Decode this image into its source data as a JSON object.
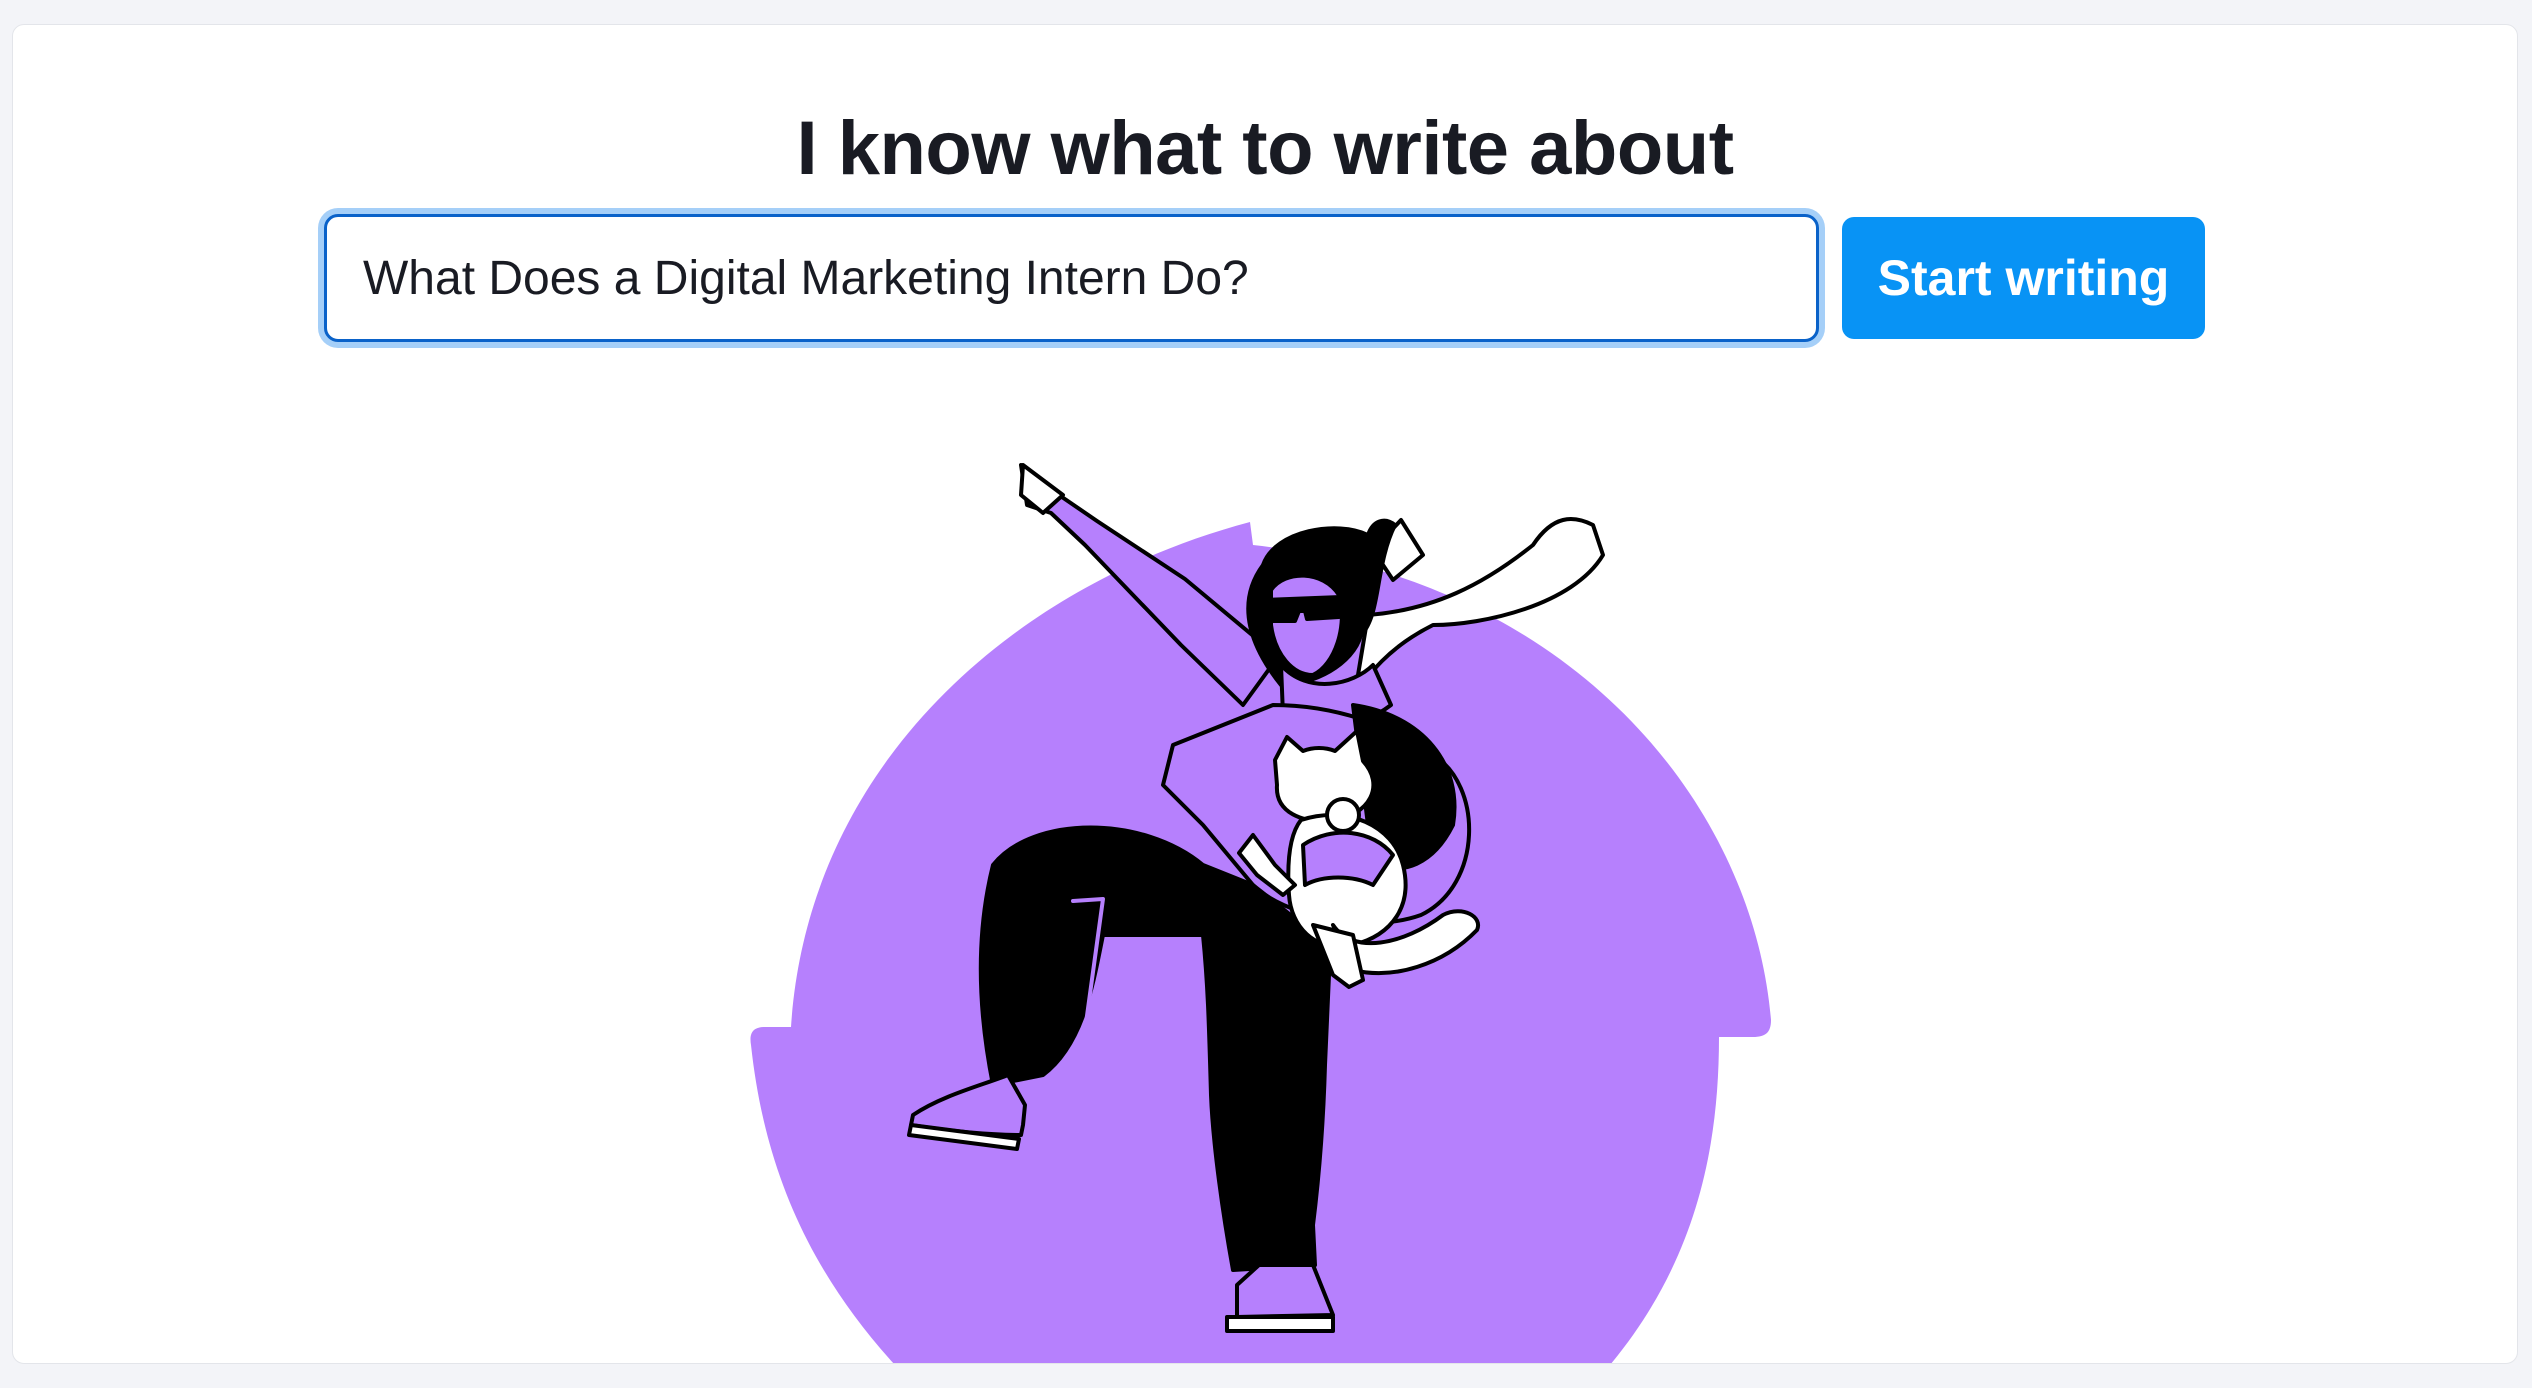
{
  "heading": "I know what to write about",
  "topic_input": {
    "value": "What Does a Digital Marketing Intern Do?"
  },
  "start_button_label": "Start writing",
  "colors": {
    "accent": "#0893f5",
    "illustration_purple": "#b680fd",
    "input_focus_border": "#0a62c9",
    "input_focus_ring": "#a5cff8"
  },
  "illustration": {
    "icon": "dancing-person-with-cat-illustration"
  }
}
